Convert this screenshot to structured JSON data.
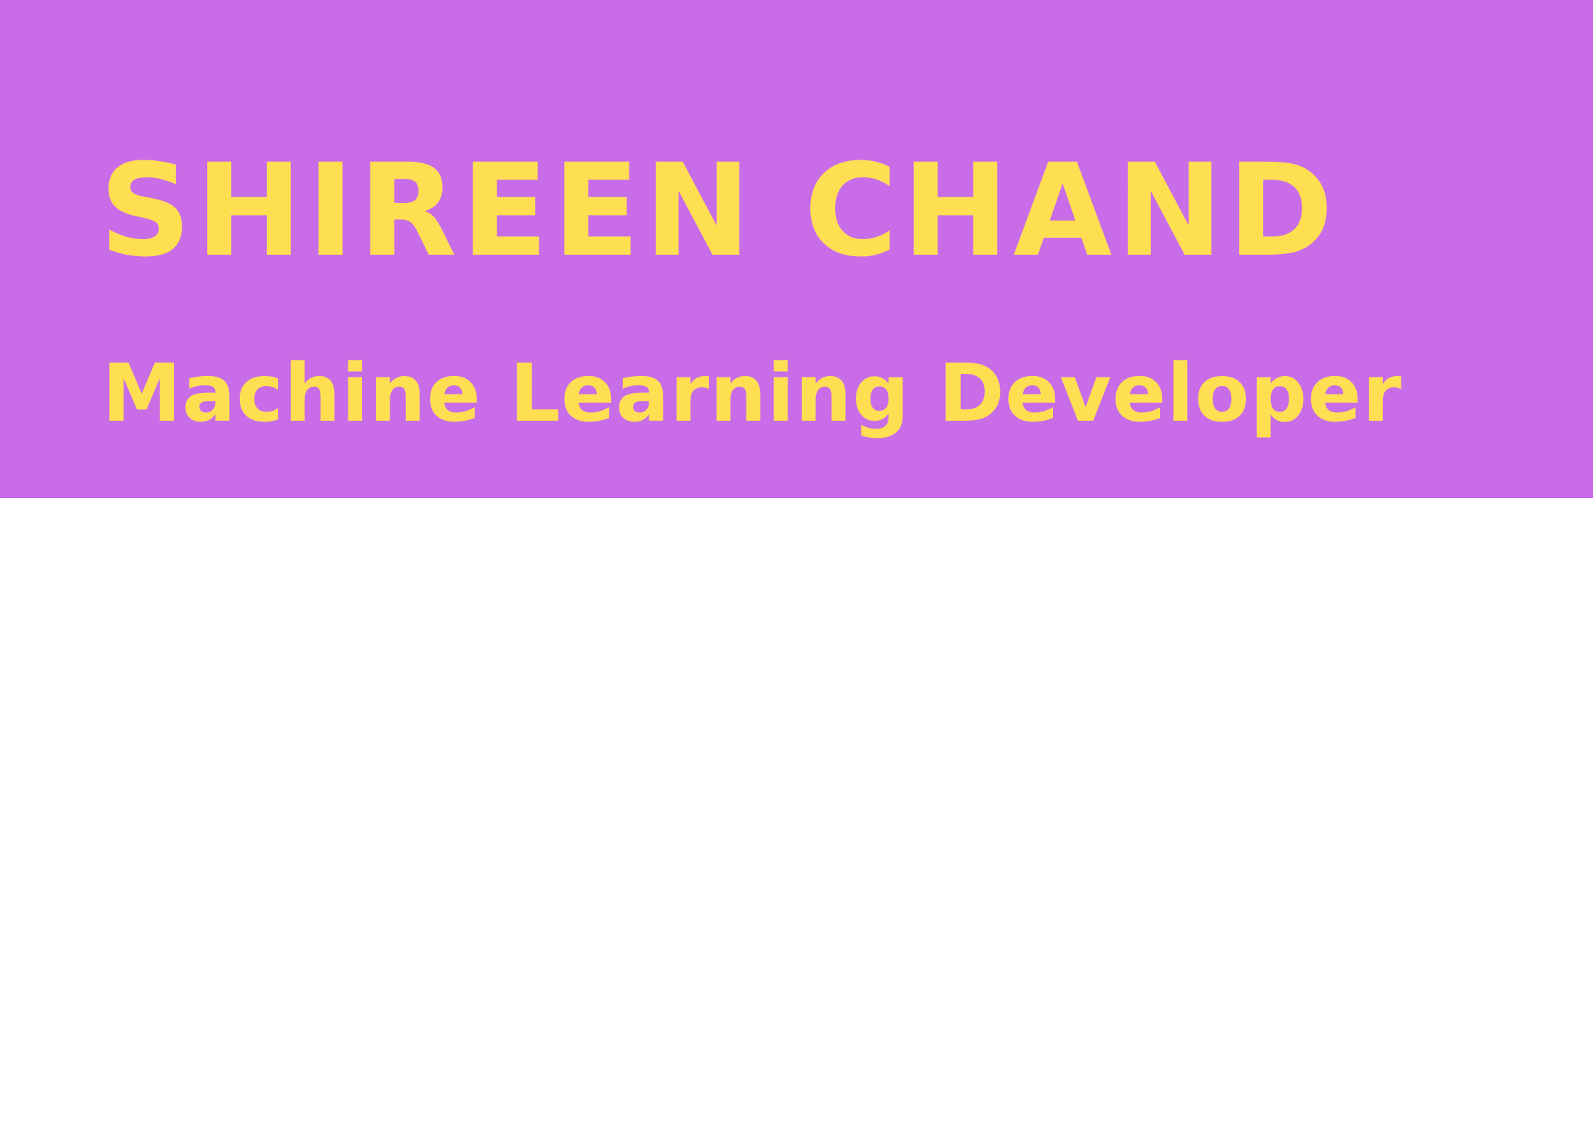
{
  "header": {
    "name": "SHIREEN CHAND",
    "title": "Machine Learning Developer"
  },
  "colors": {
    "banner_background": "#c96ce8",
    "text": "#ffdf52",
    "page_background": "#ffffff"
  }
}
